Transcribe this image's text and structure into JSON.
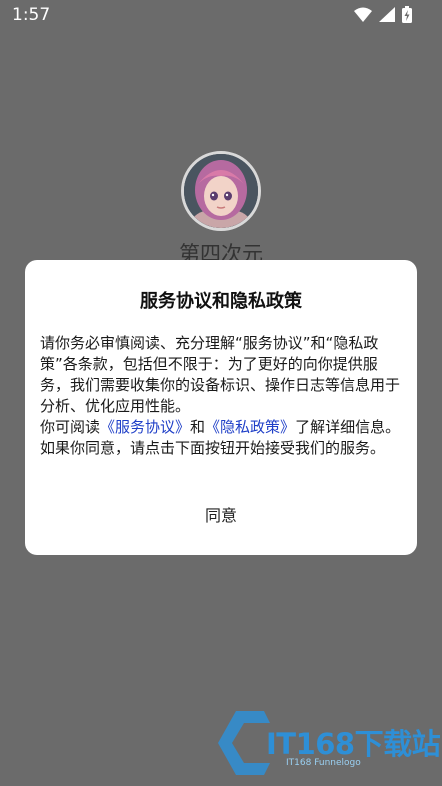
{
  "status_bar": {
    "time": "1:57"
  },
  "app": {
    "name": "第四次元"
  },
  "dialog": {
    "title": "服务协议和隐私政策",
    "para1": "请你务必审慎阅读、充分理解“服务协议”和“隐私政策”各条款，包括但不限于：为了更好的向你提供服务，我们需要收集你的设备标识、操作日志等信息用于分析、优化应用性能。",
    "para2_prefix": "你可阅读",
    "link_service": "《服务协议》",
    "para2_and": "和",
    "link_privacy": "《隐私政策》",
    "para2_suffix": "了解详细信息。如果你同意，请点击下面按钮开始接受我们的服务。",
    "agree_label": "同意"
  },
  "watermark": {
    "text": "IT168下载站",
    "sub": "IT168 Funnelogo"
  },
  "colors": {
    "overlay": "#6b6b6b",
    "link": "#2040c8",
    "watermark": "#2e8fd6"
  }
}
